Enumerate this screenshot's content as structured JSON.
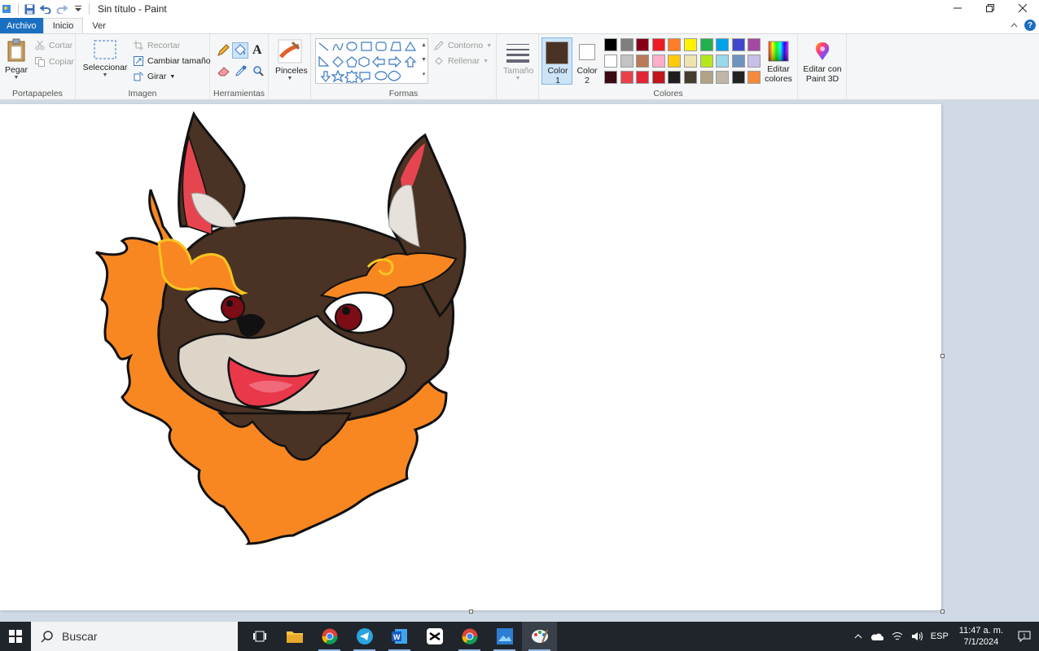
{
  "window": {
    "title": "Sin título - Paint"
  },
  "tabs": {
    "file": "Archivo",
    "home": "Inicio",
    "view": "Ver"
  },
  "clipboard": {
    "paste": "Pegar",
    "cut": "Cortar",
    "copy": "Copiar",
    "group": "Portapapeles"
  },
  "image": {
    "select": "Seleccionar",
    "crop": "Recortar",
    "resize": "Cambiar tamaño",
    "rotate": "Girar",
    "group": "Imagen"
  },
  "tools": {
    "group": "Herramientas"
  },
  "brushes": {
    "label": "Pinceles"
  },
  "shapes": {
    "outline": "Contorno",
    "fill": "Rellenar",
    "group": "Formas"
  },
  "size": {
    "label": "Tamaño"
  },
  "colors": {
    "color1_label": "Color",
    "color1_num": "1",
    "color2_label": "Color",
    "color2_num": "2",
    "edit_colors_1": "Editar",
    "edit_colors_2": "colores",
    "group": "Colores",
    "color1": "#4a3324",
    "color2": "#ffffff",
    "palette": [
      "#000000",
      "#7f7f7f",
      "#880015",
      "#ed1c24",
      "#ff7f27",
      "#fff200",
      "#22b14c",
      "#00a2e8",
      "#3f48cc",
      "#a349a4",
      "#ffffff",
      "#c3c3c3",
      "#b97a57",
      "#ffaec9",
      "#ffc90e",
      "#efe4b0",
      "#b5e61d",
      "#99d9ea",
      "#7092be",
      "#c8bfe7",
      "#3b0a12",
      "#e8414c",
      "#e32636",
      "#c0161e",
      "#1f1f1f",
      "#443d30",
      "#b0a388",
      "#bfb7a6",
      "#222222",
      "#f58a3c"
    ]
  },
  "paint3d": {
    "line1": "Editar con",
    "line2": "Paint 3D"
  },
  "taskbar": {
    "search": "Buscar",
    "lang": "ESP",
    "time": "11:47 a. m.",
    "date": "7/1/2024"
  }
}
